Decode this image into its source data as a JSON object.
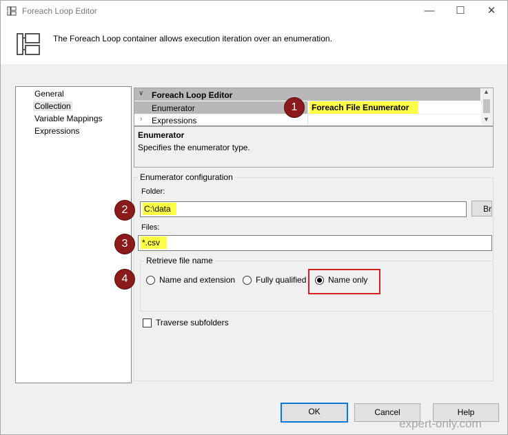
{
  "window": {
    "title": "Foreach Loop Editor",
    "minimize_glyph": "—",
    "maximize_glyph": "☐",
    "close_glyph": "✕"
  },
  "header": {
    "description": "The Foreach Loop container allows execution iteration over an enumeration."
  },
  "nav": {
    "items": [
      {
        "label": "General",
        "selected": false
      },
      {
        "label": "Collection",
        "selected": true
      },
      {
        "label": "Variable Mappings",
        "selected": false
      },
      {
        "label": "Expressions",
        "selected": false
      }
    ]
  },
  "property_grid": {
    "category": "Foreach Loop Editor",
    "rows": [
      {
        "name": "Enumerator",
        "value": "Foreach File Enumerator"
      },
      {
        "name": "Expressions",
        "value": ""
      }
    ]
  },
  "description_box": {
    "title": "Enumerator",
    "text": "Specifies the enumerator type."
  },
  "config": {
    "group_label": "Enumerator configuration",
    "folder_label": "Folder:",
    "folder_value": "C:\\data",
    "browse_label": "Br",
    "files_label": "Files:",
    "files_value": "*.csv",
    "retrieve_label": "Retrieve file name",
    "options": [
      {
        "label": "Name and extension",
        "checked": false
      },
      {
        "label": "Fully qualified",
        "checked": false
      },
      {
        "label": "Name only",
        "checked": true
      }
    ],
    "traverse_label": "Traverse subfolders",
    "traverse_checked": false
  },
  "badges": [
    "1",
    "2",
    "3",
    "4"
  ],
  "footer": {
    "ok_label": "OK",
    "cancel_label": "Cancel",
    "help_label": "Help"
  },
  "watermark": "expert-only.com",
  "colors": {
    "highlight": "#ffff45",
    "badge": "#8b1a1a",
    "annotation_frame": "#d02020",
    "default_button_border": "#0078d7"
  }
}
